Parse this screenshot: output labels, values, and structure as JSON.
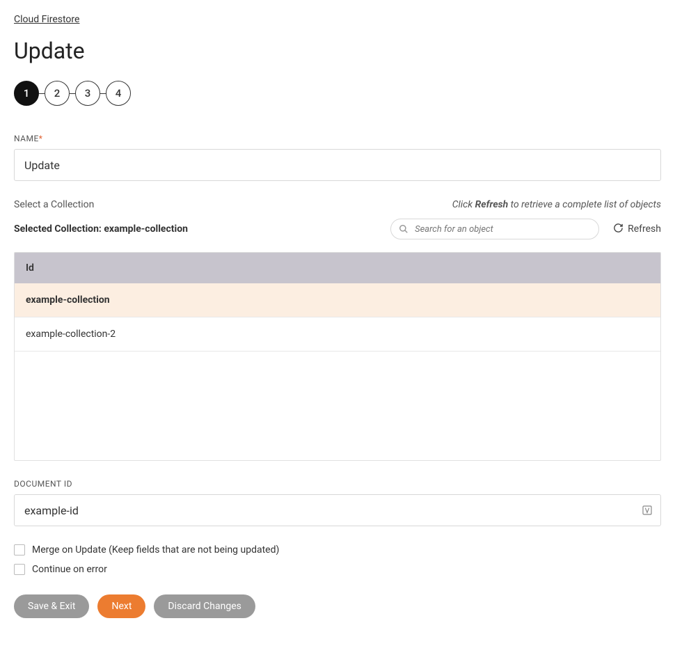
{
  "breadcrumb": "Cloud Firestore",
  "page_title": "Update",
  "stepper": {
    "steps": [
      "1",
      "2",
      "3",
      "4"
    ],
    "active": 0
  },
  "name_field": {
    "label": "NAME",
    "value": "Update"
  },
  "collection": {
    "select_label": "Select a Collection",
    "hint_prefix": "Click ",
    "hint_bold": "Refresh",
    "hint_suffix": " to retrieve a complete list of objects",
    "selected_label": "Selected Collection: ",
    "selected_value": "example-collection",
    "search_placeholder": "Search for an object",
    "refresh_label": "Refresh",
    "table_header": "Id",
    "rows": [
      {
        "id": "example-collection",
        "selected": true
      },
      {
        "id": "example-collection-2",
        "selected": false
      }
    ]
  },
  "document_id": {
    "label": "DOCUMENT ID",
    "value": "example-id"
  },
  "options": {
    "merge_label": "Merge on Update (Keep fields that are not being updated)",
    "continue_label": "Continue on error"
  },
  "buttons": {
    "save_exit": "Save & Exit",
    "next": "Next",
    "discard": "Discard Changes"
  }
}
